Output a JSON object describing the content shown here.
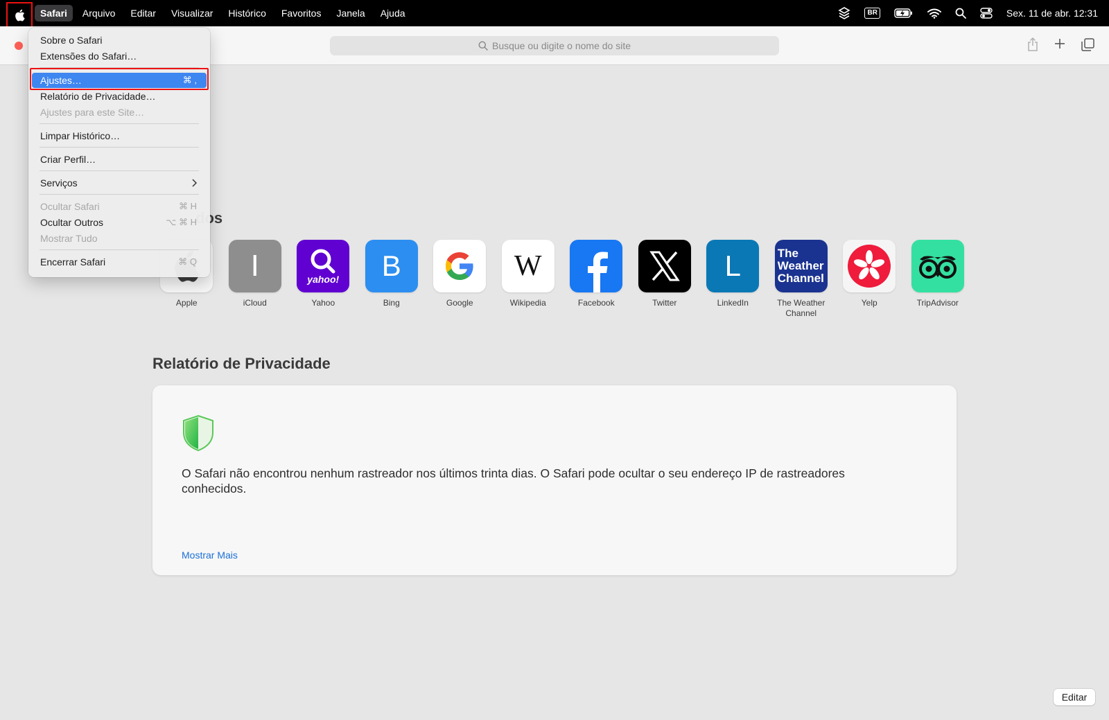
{
  "menubar": {
    "app_menu": "Safari",
    "menus": [
      "Arquivo",
      "Editar",
      "Visualizar",
      "Histórico",
      "Favoritos",
      "Janela",
      "Ajuda"
    ],
    "input_source": "BR",
    "datetime": "Sex. 11 de abr.  12:31"
  },
  "toolbar": {
    "address_placeholder": "Busque ou digite o nome do site"
  },
  "app_menu_dropdown": {
    "about": "Sobre o Safari",
    "extensions": "Extensões do Safari…",
    "settings": "Ajustes…",
    "settings_shortcut": "⌘ ,",
    "privacy_report": "Relatório de Privacidade…",
    "site_settings": "Ajustes para este Site…",
    "clear_history": "Limpar Histórico…",
    "create_profile": "Criar Perfil…",
    "services": "Serviços",
    "hide_safari": "Ocultar Safari",
    "hide_safari_shortcut": "⌘ H",
    "hide_others": "Ocultar Outros",
    "hide_others_shortcut": "⌥ ⌘ H",
    "show_all": "Mostrar Tudo",
    "quit": "Encerrar Safari",
    "quit_shortcut": "⌘ Q"
  },
  "favorites": {
    "title_partial": "dos",
    "items": [
      {
        "label": "Apple"
      },
      {
        "label": "iCloud",
        "glyph": "I",
        "color": "#8e8e8e"
      },
      {
        "label": "Yahoo",
        "glyph": "yahoo!",
        "color": "#6001d2"
      },
      {
        "label": "Bing",
        "glyph": "B",
        "color": "#2c8ef0"
      },
      {
        "label": "Google",
        "glyph": "G",
        "color": "#ffffff"
      },
      {
        "label": "Wikipedia",
        "glyph": "W",
        "color": "#ffffff"
      },
      {
        "label": "Facebook",
        "glyph": "f",
        "color": "#1877f2"
      },
      {
        "label": "Twitter",
        "glyph": "X",
        "color": "#000000"
      },
      {
        "label": "LinkedIn",
        "glyph": "L",
        "color": "#0a78b5"
      },
      {
        "label": "The Weather Channel",
        "glyph_lines": [
          "The",
          "Weather",
          "Channel"
        ],
        "color": "#1a3390"
      },
      {
        "label": "Yelp",
        "color": "#f5f5f5"
      },
      {
        "label": "TripAdvisor",
        "color": "#34e0a1"
      }
    ]
  },
  "privacy": {
    "title": "Relatório de Privacidade",
    "message": "O Safari não encontrou nenhum rastreador nos últimos trinta dias. O Safari pode ocultar o seu endereço IP de rastreadores conhecidos.",
    "more_link": "Mostrar Mais"
  },
  "edit_button": "Editar"
}
